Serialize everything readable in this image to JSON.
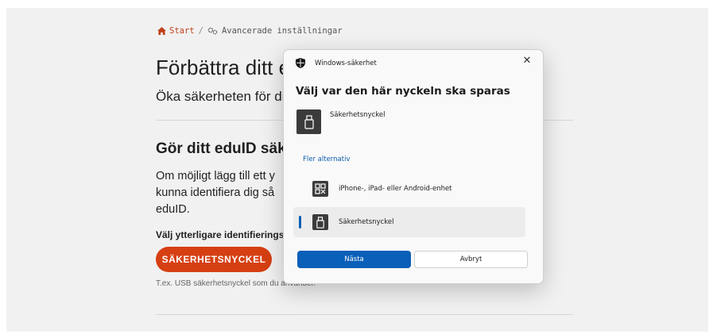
{
  "breadcrumb": {
    "home": "Start",
    "separator": "/",
    "current": "Avancerade inställningar"
  },
  "page": {
    "title": "Förbättra ditt e",
    "subtitle": "Öka säkerheten för di",
    "section_title": "Gör ditt eduID säk",
    "body_lines": [
      "Om möjligt lägg till ett y",
      "kunna identifiera dig så",
      "eduID."
    ],
    "choose_label": "Välj ytterligare identifierings",
    "security_key_button": "SÄKERHETSNYCKEL",
    "hint": "T.ex. USB säkerhetsnyckel som du använder."
  },
  "dialog": {
    "app_name": "Windows-säkerhet",
    "close_symbol": "✕",
    "title": "Välj var den här nyckeln ska sparas",
    "primary_option": "Säkerhetsnyckel",
    "more_options": "Fler alternativ",
    "options": [
      {
        "label": "iPhone-, iPad- eller Android-enhet",
        "icon": "qr-code-icon"
      },
      {
        "label": "Säkerhetsnyckel",
        "icon": "usb-key-icon",
        "selected": true
      }
    ],
    "next_button": "Nästa",
    "cancel_button": "Avbryt"
  },
  "colors": {
    "accent_orange": "#d63f12",
    "windows_blue": "#0a5fb8"
  }
}
